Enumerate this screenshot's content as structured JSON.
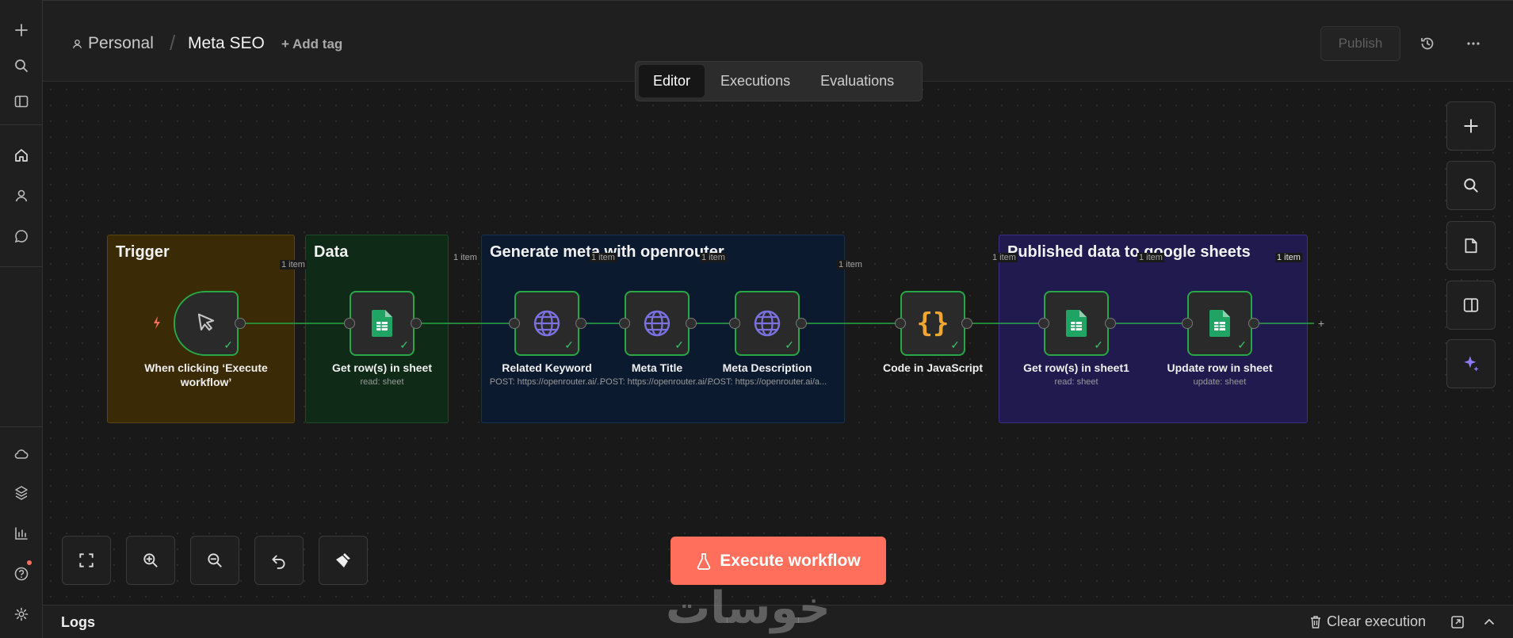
{
  "header": {
    "project": "Personal",
    "workflow_name": "Meta SEO",
    "add_tag": "+ Add tag",
    "publish": "Publish"
  },
  "tabs": [
    "Editor",
    "Executions",
    "Evaluations"
  ],
  "stickies": [
    {
      "title": "Trigger"
    },
    {
      "title": "Data"
    },
    {
      "title": "Generate meta with openrouter"
    },
    {
      "title": "Published data to google sheets"
    }
  ],
  "nodes": [
    {
      "label": "When clicking ‘Execute workflow’",
      "sub": "",
      "icon": "cursor-icon"
    },
    {
      "label": "Get row(s) in sheet",
      "sub": "read: sheet",
      "icon": "google-sheets-icon"
    },
    {
      "label": "Related Keyword",
      "sub": "POST: https://openrouter.ai/...",
      "icon": "globe-icon"
    },
    {
      "label": "Meta Title",
      "sub": "POST: https://openrouter.ai/...",
      "icon": "globe-icon"
    },
    {
      "label": "Meta Description",
      "sub": "POST: https://openrouter.ai/a...",
      "icon": "globe-icon"
    },
    {
      "label": "Code in JavaScript",
      "sub": "",
      "icon": "code-braces-icon"
    },
    {
      "label": "Get row(s) in sheet1",
      "sub": "read: sheet",
      "icon": "google-sheets-icon"
    },
    {
      "label": "Update row in sheet",
      "sub": "update: sheet",
      "icon": "google-sheets-icon"
    }
  ],
  "edge_label": "1 item",
  "execute_button": "Execute workflow",
  "logs": {
    "title": "Logs",
    "clear": "Clear execution"
  },
  "watermark": "خوسات",
  "colors": {
    "accent": "#ff6f5c",
    "success": "#28a745",
    "sticky_trigger": "#3a2a05",
    "sticky_data": "#0f2a17",
    "sticky_generate": "#0c1a30",
    "sticky_publish": "#211a4f"
  }
}
